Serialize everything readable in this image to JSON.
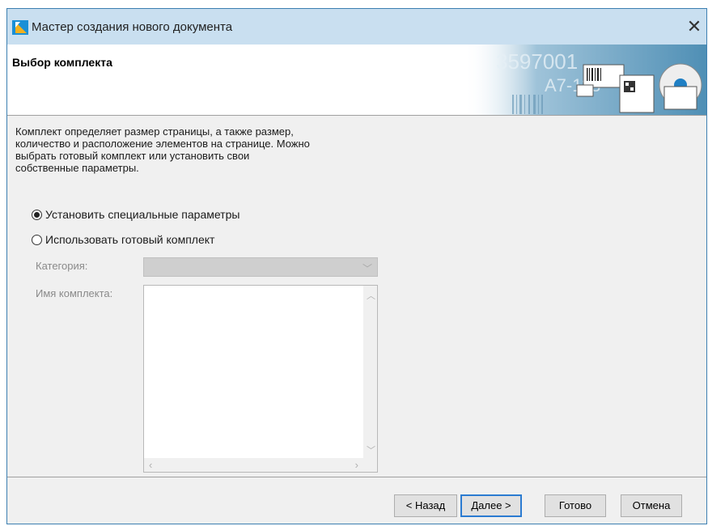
{
  "window": {
    "title": "Мастер создания нового документа",
    "close_glyph": "✕"
  },
  "header": {
    "title": "Выбор комплекта",
    "banner": {
      "number_text": "3597001",
      "code_text": "A7-118"
    }
  },
  "content": {
    "description": [
      "Комплект определяет размер страницы, а также размер,",
      "количество и расположение элементов на странице. Можно",
      "выбрать готовый комплект или установить свои",
      "собственные параметры."
    ],
    "options": [
      {
        "label": "Установить специальные параметры",
        "checked": true
      },
      {
        "label": "Использовать готовый комплект",
        "checked": false
      }
    ],
    "category_label": "Категория:",
    "category_value": "",
    "kit_name_label": "Имя комплекта:",
    "kit_items": []
  },
  "buttons": {
    "back": "< Назад",
    "next": "Далее >",
    "finish": "Готово",
    "cancel": "Отмена"
  },
  "colors": {
    "titlebar": "#c9dff0",
    "accent": "#2b7bd1"
  }
}
